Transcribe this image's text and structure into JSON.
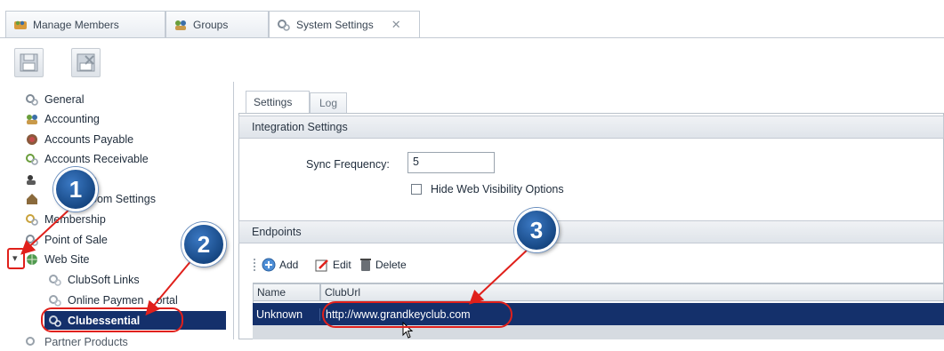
{
  "doc_tabs": [
    {
      "label": "Manage Members",
      "icon": "people-icon"
    },
    {
      "label": "Groups",
      "icon": "groups-icon"
    },
    {
      "label": "System Settings",
      "icon": "gear-icon",
      "active": true,
      "close": "✕"
    }
  ],
  "toolbar": {
    "buttons": [
      "save-icon",
      "discard-icon"
    ]
  },
  "tree": {
    "items": [
      {
        "label": "General",
        "icon": "gear-icon"
      },
      {
        "label": "Accounting",
        "icon": "people-icon"
      },
      {
        "label": "Accounts Payable",
        "icon": "stack-icon"
      },
      {
        "label": "Accounts Receivable",
        "icon": "gear-icon"
      },
      {
        "label": "e",
        "icon": "people-icon"
      },
      {
        "label": "oom Settings",
        "icon": "house-icon"
      },
      {
        "label": "Membership",
        "icon": "gear-icon"
      },
      {
        "label": "Point of Sale",
        "icon": "gear-icon"
      },
      {
        "label": "Web Site",
        "icon": "globe-icon"
      },
      {
        "label": "ClubSoft Links",
        "icon": "gear-icon"
      },
      {
        "label": "Online Paymen",
        "label_tail": "ortal",
        "icon": "gear-icon"
      },
      {
        "label": "Clubessential",
        "icon": "gear-icon",
        "selected": true
      },
      {
        "label": "Partner Products",
        "icon": "gear-icon"
      }
    ],
    "expander": "▾"
  },
  "settings_tabs": [
    "Settings",
    "Log"
  ],
  "integration": {
    "header": "Integration Settings",
    "sync_label": "Sync Frequency:",
    "sync_value": "5",
    "hide_web_label": "Hide Web Visibility Options",
    "hide_web_checked": false
  },
  "endpoints": {
    "header": "Endpoints",
    "actions": {
      "add": "Add",
      "edit": "Edit",
      "delete": "Delete"
    },
    "columns": [
      "Name",
      "ClubUrl"
    ],
    "rows": [
      {
        "name": "Unknown",
        "url": "http://www.grandkeyclub.com"
      }
    ]
  },
  "annotations": {
    "badges": [
      "1",
      "2",
      "3"
    ],
    "color": "#e0201b"
  }
}
